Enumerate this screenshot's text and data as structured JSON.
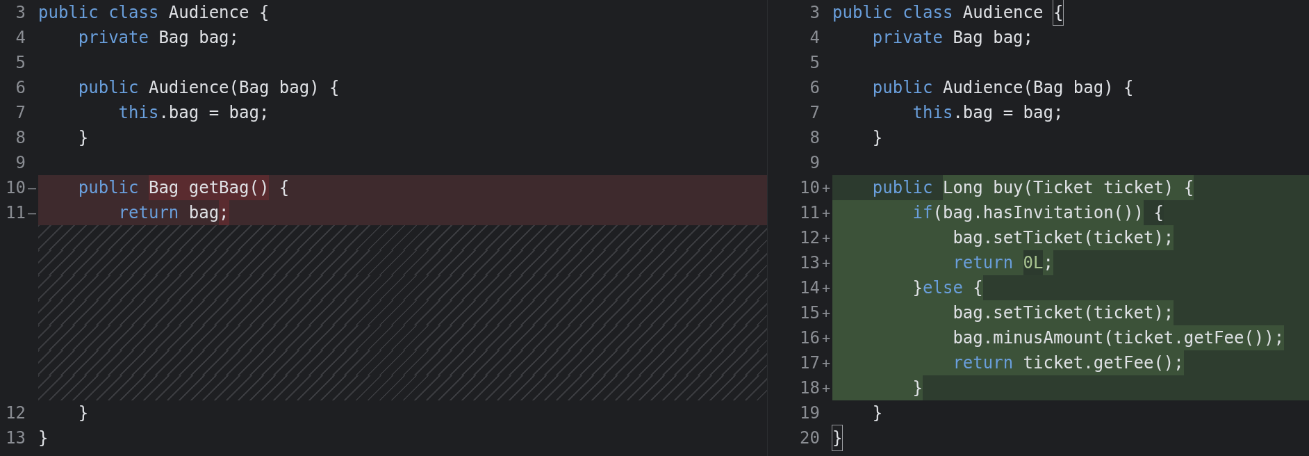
{
  "panes": [
    {
      "lines": [
        {
          "number": "3",
          "kind": "context",
          "segments": [
            {
              "text": "public class",
              "kind": "keyword"
            },
            {
              "text": " Audience {",
              "kind": "plain"
            }
          ]
        },
        {
          "number": "4",
          "kind": "context",
          "segments": [
            {
              "text": "    private",
              "kind": "keyword"
            },
            {
              "text": " Bag bag;",
              "kind": "plain"
            }
          ]
        },
        {
          "number": "5",
          "kind": "context"
        },
        {
          "number": "6",
          "kind": "context",
          "segments": [
            {
              "text": "    public",
              "kind": "keyword"
            },
            {
              "text": " Audience(Bag bag) {",
              "kind": "plain"
            }
          ]
        },
        {
          "number": "7",
          "kind": "context",
          "segments": [
            {
              "text": "        this",
              "kind": "keyword"
            },
            {
              "text": ".bag = bag;",
              "kind": "plain"
            }
          ]
        },
        {
          "number": "8",
          "kind": "context",
          "segments": [
            {
              "text": "    }",
              "kind": "plain"
            }
          ]
        },
        {
          "number": "9",
          "kind": "context"
        },
        {
          "number": "10",
          "kind": "deleted",
          "marker": "—",
          "segments": [
            {
              "text": "    public ",
              "kind": "keyword",
              "highlight": false
            },
            {
              "text": "Bag getBag()",
              "kind": "plain",
              "highlight": true
            },
            {
              "text": " {",
              "kind": "plain",
              "highlight": false
            }
          ]
        },
        {
          "number": "11",
          "kind": "deleted",
          "marker": "—",
          "segments": [
            {
              "text": "        return ",
              "kind": "keyword",
              "highlight": false
            },
            {
              "text": "bag",
              "kind": "plain",
              "highlight": false
            },
            {
              "text": ";",
              "kind": "plain",
              "highlight": true
            }
          ]
        },
        {
          "kind": "filler"
        },
        {
          "kind": "filler"
        },
        {
          "kind": "filler"
        },
        {
          "kind": "filler"
        },
        {
          "kind": "filler"
        },
        {
          "kind": "filler"
        },
        {
          "kind": "filler"
        },
        {
          "number": "12",
          "kind": "context",
          "segments": [
            {
              "text": "    }",
              "kind": "plain"
            }
          ]
        },
        {
          "number": "13",
          "kind": "context",
          "segments": [
            {
              "text": "}",
              "kind": "plain"
            }
          ]
        }
      ]
    },
    {
      "lines": [
        {
          "number": "3",
          "kind": "context",
          "segments": [
            {
              "text": "public class",
              "kind": "keyword"
            },
            {
              "text": " Audience ",
              "kind": "plain"
            },
            {
              "text": "{",
              "kind": "plain",
              "boxed": true
            }
          ]
        },
        {
          "number": "4",
          "kind": "context",
          "segments": [
            {
              "text": "    private",
              "kind": "keyword"
            },
            {
              "text": " Bag bag;",
              "kind": "plain"
            }
          ]
        },
        {
          "number": "5",
          "kind": "context"
        },
        {
          "number": "6",
          "kind": "context",
          "segments": [
            {
              "text": "    public",
              "kind": "keyword"
            },
            {
              "text": " Audience(Bag bag) {",
              "kind": "plain"
            }
          ]
        },
        {
          "number": "7",
          "kind": "context",
          "segments": [
            {
              "text": "        this",
              "kind": "keyword"
            },
            {
              "text": ".bag = bag;",
              "kind": "plain"
            }
          ]
        },
        {
          "number": "8",
          "kind": "context",
          "segments": [
            {
              "text": "    }",
              "kind": "plain"
            }
          ]
        },
        {
          "number": "9",
          "kind": "context"
        },
        {
          "number": "10",
          "kind": "added",
          "marker": "+",
          "segments": [
            {
              "text": "    public ",
              "kind": "keyword",
              "highlight": false
            },
            {
              "text": "Long buy(Ticket ticket) {",
              "kind": "plain",
              "highlight": true
            }
          ]
        },
        {
          "number": "11",
          "kind": "added",
          "marker": "+",
          "segments": [
            {
              "text": "        if",
              "kind": "keyword",
              "highlight": true
            },
            {
              "text": "(bag.hasInvitation())",
              "kind": "plain",
              "highlight": true
            },
            {
              "text": " {",
              "kind": "plain",
              "highlight": false
            }
          ]
        },
        {
          "number": "12",
          "kind": "added",
          "marker": "+",
          "segments": [
            {
              "text": "            bag.setTicket(ticket);",
              "kind": "plain",
              "highlight": true
            }
          ]
        },
        {
          "number": "13",
          "kind": "added",
          "marker": "+",
          "segments": [
            {
              "text": "            return ",
              "kind": "keyword",
              "highlight": true
            },
            {
              "text": "0L",
              "kind": "number",
              "highlight": false
            },
            {
              "text": ";",
              "kind": "plain",
              "highlight": true
            }
          ]
        },
        {
          "number": "14",
          "kind": "added",
          "marker": "+",
          "segments": [
            {
              "text": "        }",
              "kind": "plain",
              "highlight": true
            },
            {
              "text": "else",
              "kind": "keyword",
              "highlight": true
            },
            {
              "text": " {",
              "kind": "plain",
              "highlight": true
            }
          ]
        },
        {
          "number": "15",
          "kind": "added",
          "marker": "+",
          "segments": [
            {
              "text": "            bag",
              "kind": "plain",
              "highlight": true
            },
            {
              "text": ".setTicket(ticket);",
              "kind": "plain",
              "highlight": true
            }
          ]
        },
        {
          "number": "16",
          "kind": "added",
          "marker": "+",
          "segments": [
            {
              "text": "            bag.minusAmount(ticket.getFee());",
              "kind": "plain",
              "highlight": true
            }
          ]
        },
        {
          "number": "17",
          "kind": "added",
          "marker": "+",
          "segments": [
            {
              "text": "            return ",
              "kind": "keyword",
              "highlight": true
            },
            {
              "text": "ticket.getFee();",
              "kind": "plain",
              "highlight": true
            }
          ]
        },
        {
          "number": "18",
          "kind": "added",
          "marker": "+",
          "segments": [
            {
              "text": "        }",
              "kind": "plain",
              "highlight": true
            }
          ]
        },
        {
          "number": "19",
          "kind": "context",
          "segments": [
            {
              "text": "    }",
              "kind": "plain"
            }
          ]
        },
        {
          "number": "20",
          "kind": "context",
          "segments": [
            {
              "text": "}",
              "kind": "plain",
              "boxed": true
            }
          ]
        }
      ]
    }
  ]
}
